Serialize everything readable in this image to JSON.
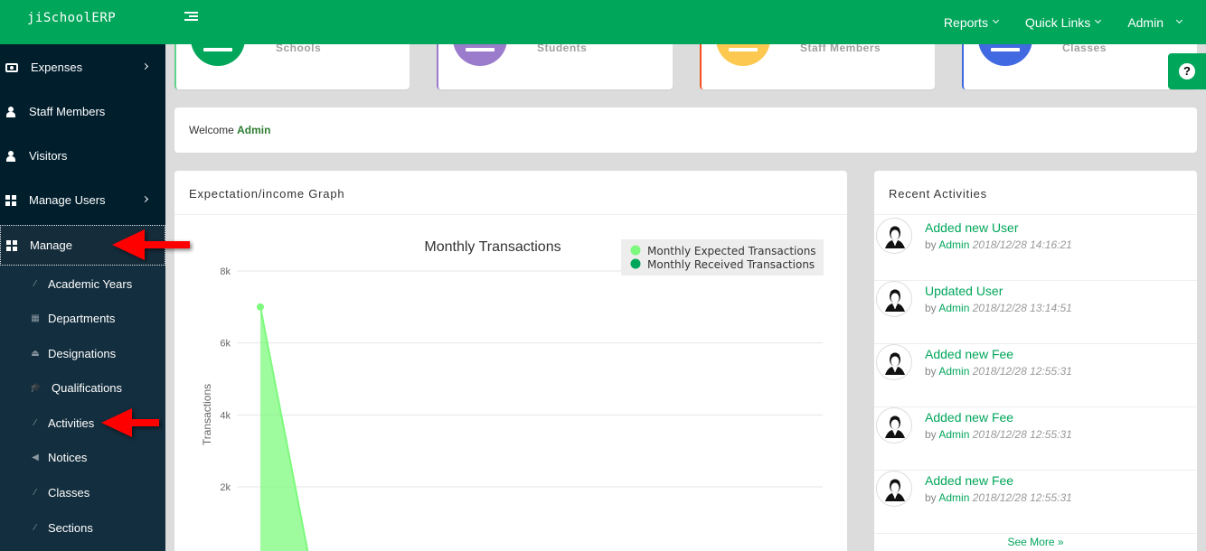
{
  "header": {
    "brand": "jiSchoolERP",
    "nav": [
      {
        "label": "Reports"
      },
      {
        "label": "Quick Links"
      },
      {
        "label": "Admin"
      }
    ],
    "brand_color": "#00a65a"
  },
  "sidebar": {
    "items": [
      {
        "label": "Expenses",
        "icon": "money-icon",
        "has_submenu": true
      },
      {
        "label": "Staff Members",
        "icon": "user-icon",
        "has_submenu": false
      },
      {
        "label": "Visitors",
        "icon": "user-icon",
        "has_submenu": false
      },
      {
        "label": "Manage Users",
        "icon": "grid-icon",
        "has_submenu": true
      },
      {
        "label": "Manage",
        "icon": "grid-icon",
        "has_submenu": false,
        "active": true
      }
    ],
    "submenu": [
      {
        "label": "Academic Years",
        "icon": "magic-wand-icon",
        "glyph": "⁄"
      },
      {
        "label": "Departments",
        "icon": "table-icon",
        "glyph": "▦"
      },
      {
        "label": "Designations",
        "icon": "eject-icon",
        "glyph": "⏏"
      },
      {
        "label": "Qualifications",
        "icon": "graduation-cap-icon",
        "glyph": "🎓"
      },
      {
        "label": "Activities",
        "icon": "magic-wand-icon",
        "glyph": "⁄"
      },
      {
        "label": "Notices",
        "icon": "volume-icon",
        "glyph": "◀"
      },
      {
        "label": "Classes",
        "icon": "magic-wand-icon",
        "glyph": "⁄"
      },
      {
        "label": "Sections",
        "icon": "magic-wand-icon",
        "glyph": "⁄"
      }
    ]
  },
  "stat_cards": [
    {
      "label": "Schools",
      "color": "#00a65a",
      "border": "#5fd38c"
    },
    {
      "label": "Students",
      "color": "#9b7ccc",
      "border": "#9b7ccc"
    },
    {
      "label": "Staff Members",
      "color": "#fcc850",
      "border": "#f4511e"
    },
    {
      "label": "Classes",
      "color": "#4169e1",
      "border": "#4169e1"
    }
  ],
  "welcome": {
    "prefix": "Welcome",
    "user": "Admin"
  },
  "graph_card": {
    "title": "Expectation/income Graph"
  },
  "chart_data": {
    "type": "area",
    "title": "Monthly Transactions",
    "xlabel": "",
    "ylabel": "Transactions",
    "ylim": [
      0,
      8000
    ],
    "yticks": [
      "2k",
      "4k",
      "6k",
      "8k"
    ],
    "ytick_values": [
      2000,
      4000,
      6000,
      8000
    ],
    "grid": true,
    "legend_position": "top-right",
    "x_count": 12,
    "series": [
      {
        "name": "Monthly Expected Transactions",
        "color": "#7dfa7d",
        "values": [
          7000,
          0,
          0,
          0,
          0,
          0,
          0,
          0,
          0,
          0,
          0,
          0
        ]
      },
      {
        "name": "Monthly Received Transactions",
        "color": "#00a65a",
        "values": [
          0,
          0,
          0,
          0,
          0,
          0,
          0,
          0,
          0,
          0,
          0,
          0
        ]
      }
    ]
  },
  "recent": {
    "title": "Recent Activities",
    "items": [
      {
        "title": "Added new User",
        "by": "by",
        "user": "Admin",
        "time": "2018/12/28 14:16:21"
      },
      {
        "title": "Updated User",
        "by": "by",
        "user": "Admin",
        "time": "2018/12/28 13:14:51"
      },
      {
        "title": "Added new Fee",
        "by": "by",
        "user": "Admin",
        "time": "2018/12/28 12:55:31"
      },
      {
        "title": "Added new Fee",
        "by": "by",
        "user": "Admin",
        "time": "2018/12/28 12:55:31"
      },
      {
        "title": "Added new Fee",
        "by": "by",
        "user": "Admin",
        "time": "2018/12/28 12:55:31"
      }
    ],
    "see_more": "See More »"
  },
  "help": {
    "glyph": "?"
  }
}
